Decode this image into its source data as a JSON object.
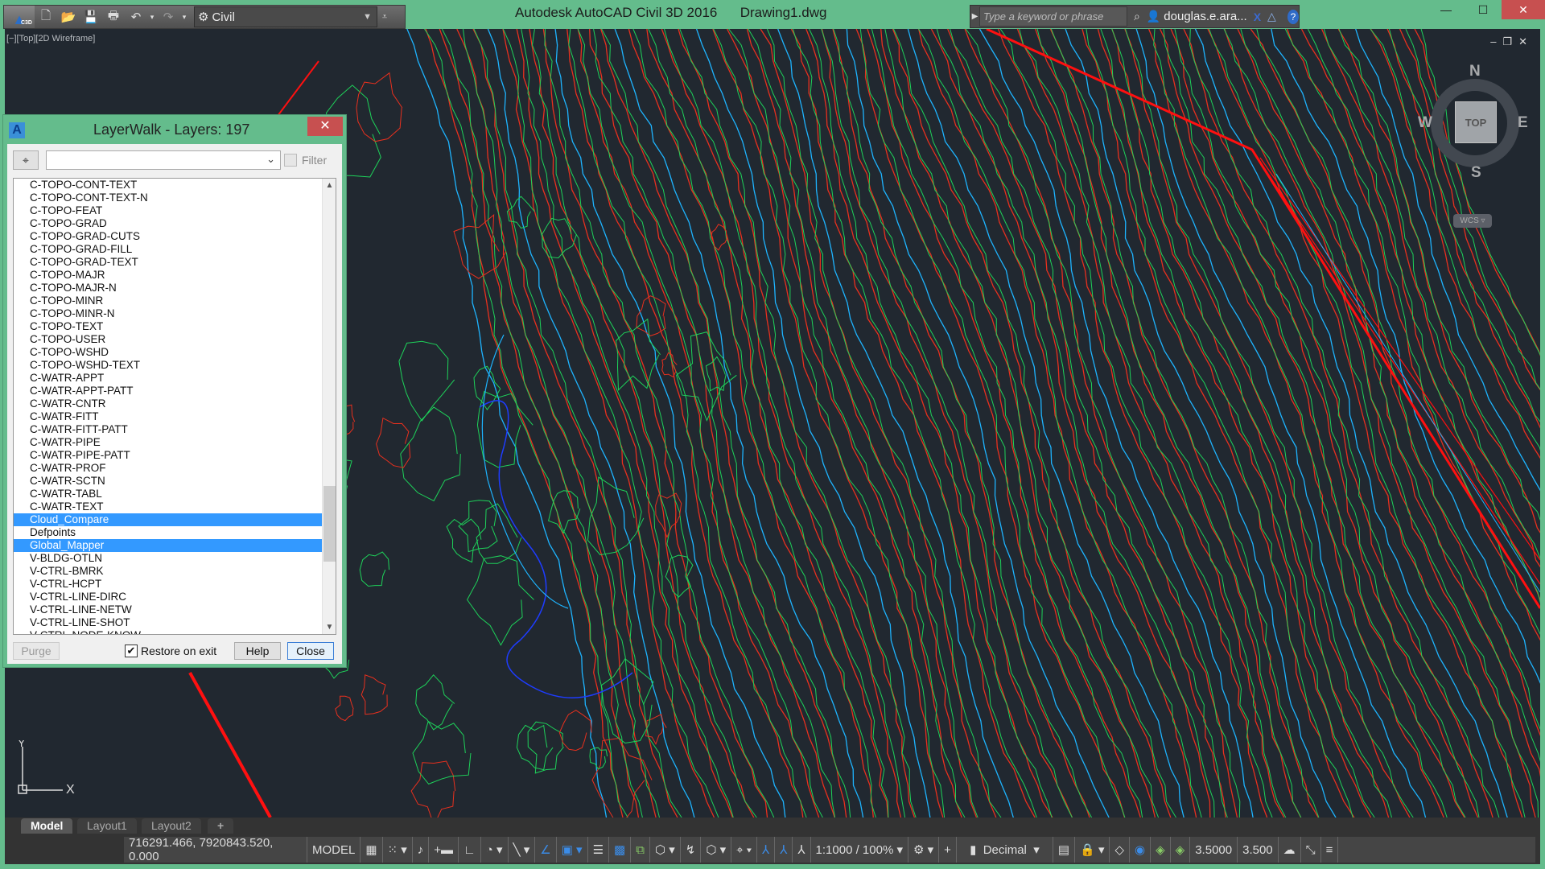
{
  "titlebar": {
    "app_title": "Autodesk AutoCAD Civil 3D 2016",
    "document": "Drawing1.dwg",
    "app_button_badge": "C3D",
    "workspace": "Civil",
    "search_placeholder": "Type a keyword or phrase",
    "user": "douglas.e.ara...",
    "icons": [
      "new-icon",
      "open-icon",
      "save-icon",
      "print-icon",
      "undo-icon",
      "redo-icon",
      "gear-icon",
      "binoculars-icon",
      "user-icon",
      "exchange-icon",
      "a360-icon",
      "help-icon"
    ]
  },
  "viewport": {
    "label": "[−][Top][2D Wireframe]",
    "viewcube": {
      "top": "TOP",
      "n": "N",
      "s": "S",
      "e": "E",
      "w": "W",
      "ucs": "WCS"
    },
    "ucs_x": "X",
    "ucs_y": "Y",
    "colors": {
      "background": "#212830",
      "contour_red": "#e8301e",
      "contour_green": "#1ed25a",
      "contour_cyan": "#1eb4ff",
      "contour_blue": "#1e3cff",
      "boundary": "#ff1010"
    }
  },
  "dialog": {
    "title": "LayerWalk - Layers: 197",
    "filter_label": "Filter",
    "filter_checked": false,
    "combo_value": "",
    "layers": [
      {
        "name": "C-TOPO-CONT-TEXT",
        "selected": false
      },
      {
        "name": "C-TOPO-CONT-TEXT-N",
        "selected": false
      },
      {
        "name": "C-TOPO-FEAT",
        "selected": false
      },
      {
        "name": "C-TOPO-GRAD",
        "selected": false
      },
      {
        "name": "C-TOPO-GRAD-CUTS",
        "selected": false
      },
      {
        "name": "C-TOPO-GRAD-FILL",
        "selected": false
      },
      {
        "name": "C-TOPO-GRAD-TEXT",
        "selected": false
      },
      {
        "name": "C-TOPO-MAJR",
        "selected": false
      },
      {
        "name": "C-TOPO-MAJR-N",
        "selected": false
      },
      {
        "name": "C-TOPO-MINR",
        "selected": false
      },
      {
        "name": "C-TOPO-MINR-N",
        "selected": false
      },
      {
        "name": "C-TOPO-TEXT",
        "selected": false
      },
      {
        "name": "C-TOPO-USER",
        "selected": false
      },
      {
        "name": "C-TOPO-WSHD",
        "selected": false
      },
      {
        "name": "C-TOPO-WSHD-TEXT",
        "selected": false
      },
      {
        "name": "C-WATR-APPT",
        "selected": false
      },
      {
        "name": "C-WATR-APPT-PATT",
        "selected": false
      },
      {
        "name": "C-WATR-CNTR",
        "selected": false
      },
      {
        "name": "C-WATR-FITT",
        "selected": false
      },
      {
        "name": "C-WATR-FITT-PATT",
        "selected": false
      },
      {
        "name": "C-WATR-PIPE",
        "selected": false
      },
      {
        "name": "C-WATR-PIPE-PATT",
        "selected": false
      },
      {
        "name": "C-WATR-PROF",
        "selected": false
      },
      {
        "name": "C-WATR-SCTN",
        "selected": false
      },
      {
        "name": "C-WATR-TABL",
        "selected": false
      },
      {
        "name": "C-WATR-TEXT",
        "selected": false
      },
      {
        "name": "Cloud_Compare",
        "selected": true
      },
      {
        "name": "Defpoints",
        "selected": false
      },
      {
        "name": "Global_Mapper",
        "selected": true
      },
      {
        "name": "V-BLDG-OTLN",
        "selected": false
      },
      {
        "name": "V-CTRL-BMRK",
        "selected": false
      },
      {
        "name": "V-CTRL-HCPT",
        "selected": false
      },
      {
        "name": "V-CTRL-LINE-DIRC",
        "selected": false
      },
      {
        "name": "V-CTRL-LINE-NETW",
        "selected": false
      },
      {
        "name": "V-CTRL-LINE-SHOT",
        "selected": false
      },
      {
        "name": "V-CTRL-NODE-KNOW",
        "selected": false
      }
    ],
    "purge_label": "Purge",
    "restore_label": "Restore on exit",
    "restore_checked": true,
    "help_label": "Help",
    "close_label": "Close",
    "selection_color": "#3399ff"
  },
  "layout_tabs": [
    {
      "label": "Model",
      "active": true
    },
    {
      "label": "Layout1",
      "active": false
    },
    {
      "label": "Layout2",
      "active": false
    },
    {
      "label": "+",
      "active": false
    }
  ],
  "statusbar": {
    "coordinates": "716291.466, 7920843.520, 0.000",
    "space": "MODEL",
    "annotation_scale": "1:1000 / 100%",
    "units": "Decimal",
    "value1": "3.5000",
    "value2": "3.500"
  }
}
